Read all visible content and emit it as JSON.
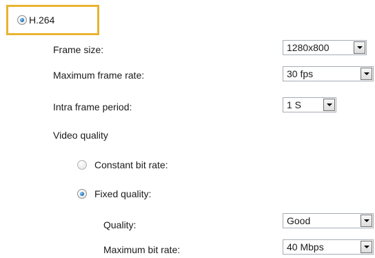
{
  "codec": {
    "label": "H.264",
    "selected": true
  },
  "fields": {
    "frame_size": {
      "label": "Frame size:",
      "value": "1280x800"
    },
    "max_frame_rate": {
      "label": "Maximum frame rate:",
      "value": "30 fps"
    },
    "intra_frame_period": {
      "label": "Intra frame period:",
      "value": "1 S"
    }
  },
  "video_quality": {
    "heading": "Video quality",
    "constant_bit_rate": {
      "label": "Constant bit rate:",
      "selected": false
    },
    "fixed_quality": {
      "label": "Fixed quality:",
      "selected": true
    },
    "quality": {
      "label": "Quality:",
      "value": "Good"
    },
    "max_bit_rate": {
      "label": "Maximum bit rate:",
      "value": "40 Mbps"
    }
  },
  "colors": {
    "highlight": "#e9b42e",
    "radio_selected": "#2a7cc7"
  }
}
